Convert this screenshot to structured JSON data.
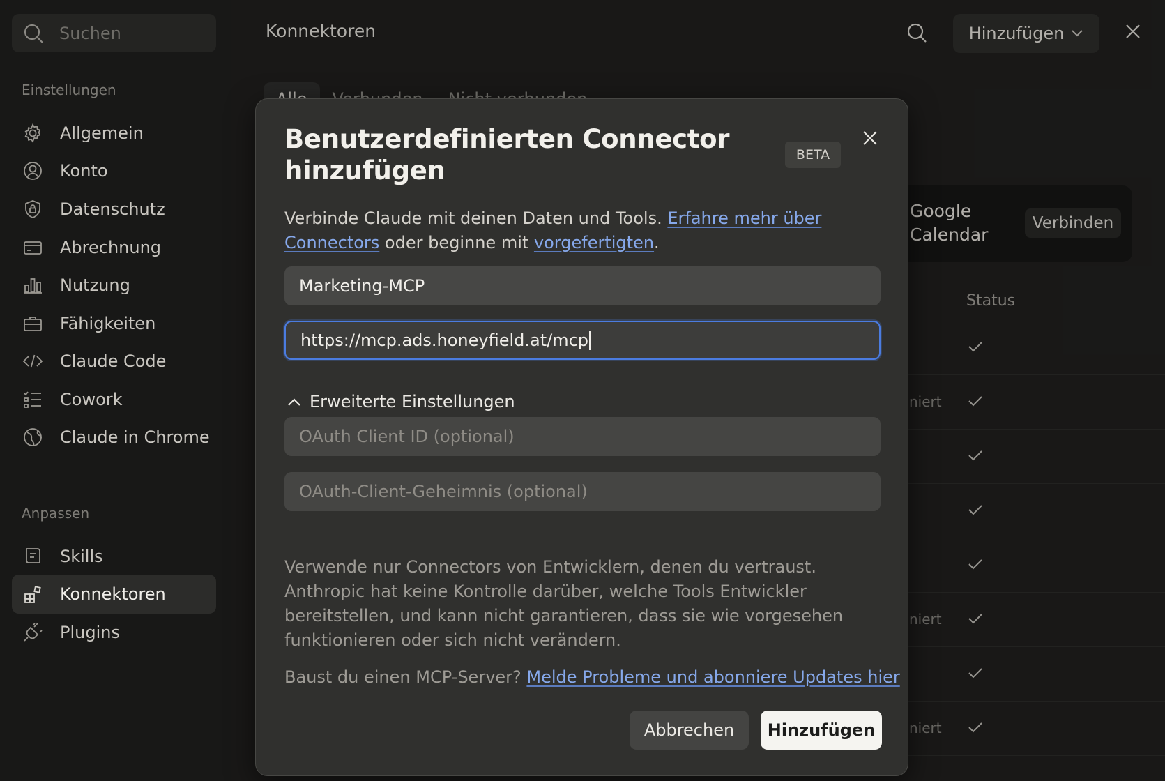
{
  "sidebar": {
    "search_placeholder": "Suchen",
    "section_settings": "Einstellungen",
    "settings_items": [
      {
        "label": "Allgemein",
        "icon": "gear-icon"
      },
      {
        "label": "Konto",
        "icon": "user-circle-icon"
      },
      {
        "label": "Datenschutz",
        "icon": "shield-icon"
      },
      {
        "label": "Abrechnung",
        "icon": "credit-card-icon"
      },
      {
        "label": "Nutzung",
        "icon": "bar-chart-icon"
      },
      {
        "label": "Fähigkeiten",
        "icon": "briefcase-icon"
      },
      {
        "label": "Claude Code",
        "icon": "code-icon"
      },
      {
        "label": "Cowork",
        "icon": "list-icon"
      },
      {
        "label": "Claude in Chrome",
        "icon": "globe-icon"
      }
    ],
    "section_customize": "Anpassen",
    "customize_items": [
      {
        "label": "Skills",
        "icon": "skills-icon"
      },
      {
        "label": "Konnektoren",
        "icon": "connectors-icon",
        "active": true
      },
      {
        "label": "Plugins",
        "icon": "plug-icon"
      }
    ]
  },
  "main": {
    "title": "Konnektoren",
    "add_button": "Hinzufügen",
    "tabs": [
      "Alle",
      "Verbunden",
      "Nicht verbunden"
    ],
    "google_calendar": {
      "name": "Google Calendar",
      "button": "Verbinden"
    },
    "status_header": "Status",
    "row_fragment": "niert"
  },
  "modal": {
    "title": "Benutzerdefinierten Connector hinzufügen",
    "badge": "BETA",
    "intro_text": "Verbinde Claude mit deinen Daten und Tools. ",
    "intro_link1": "Erfahre mehr über Connectors",
    "intro_mid": " oder beginne mit ",
    "intro_link2": "vorgefertigten",
    "intro_end": ".",
    "name_value": "Marketing-MCP",
    "url_value": "https://mcp.ads.honeyfield.at/mcp",
    "advanced_label": "Erweiterte Einstellungen",
    "client_id_placeholder": "OAuth Client ID (optional)",
    "client_secret_placeholder": "OAuth-Client-Geheimnis (optional)",
    "warning": "Verwende nur Connectors von Entwicklern, denen du vertraust. Anthropic hat keine Kontrolle darüber, welche Tools Entwickler bereitstellen, und kann nicht garantieren, dass sie wie vorgesehen funktionieren oder sich nicht verändern.",
    "mcp_prefix": "Baust du einen MCP-Server? ",
    "mcp_link": "Melde Probleme und abonniere Updates hier",
    "cancel_label": "Abbrechen",
    "add_label": "Hinzufügen"
  },
  "colors": {
    "accent_link": "#86a8ea",
    "focus_ring": "#4b7ce0",
    "primary_button": "#f5f4f0"
  }
}
